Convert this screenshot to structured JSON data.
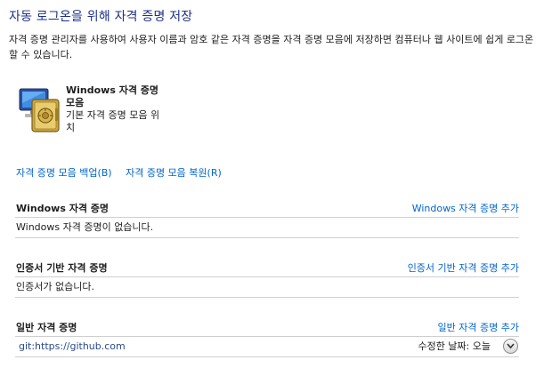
{
  "header": {
    "title": "자동 로그온을 위해 자격 증명 저장",
    "description": "자격 증명 관리자를 사용하여 사용자 이름과 암호 같은 자격 증명을 자격 증명 모음에 저장하면 컴퓨터나 웹 사이트에 쉽게 로그온할 수 있습니다."
  },
  "vault": {
    "icon": "credential-vault-icon",
    "title": "Windows 자격 증명 모음",
    "subtitle": "기본 자격 증명 모음 위치"
  },
  "links": {
    "backup": "자격 증명 모음 백업(B)",
    "restore": "자격 증명 모음 복원(R)"
  },
  "sections": {
    "windows": {
      "title": "Windows 자격 증명",
      "add": "Windows 자격 증명 추가",
      "empty": "Windows 자격 증명이 없습니다."
    },
    "certificate": {
      "title": "인증서 기반 자격 증명",
      "add": "인증서 기반 자격 증명 추가",
      "empty": "인증서가 없습니다."
    },
    "generic": {
      "title": "일반 자격 증명",
      "add": "일반 자격 증명 추가",
      "items": [
        {
          "name": "git:https://github.com",
          "modified": "수정한 날짜:  오늘",
          "icon": "chevron-down-icon"
        }
      ]
    }
  },
  "colors": {
    "title": "#1e3287",
    "link": "#0066cc",
    "divider": "#cfcfcf"
  }
}
